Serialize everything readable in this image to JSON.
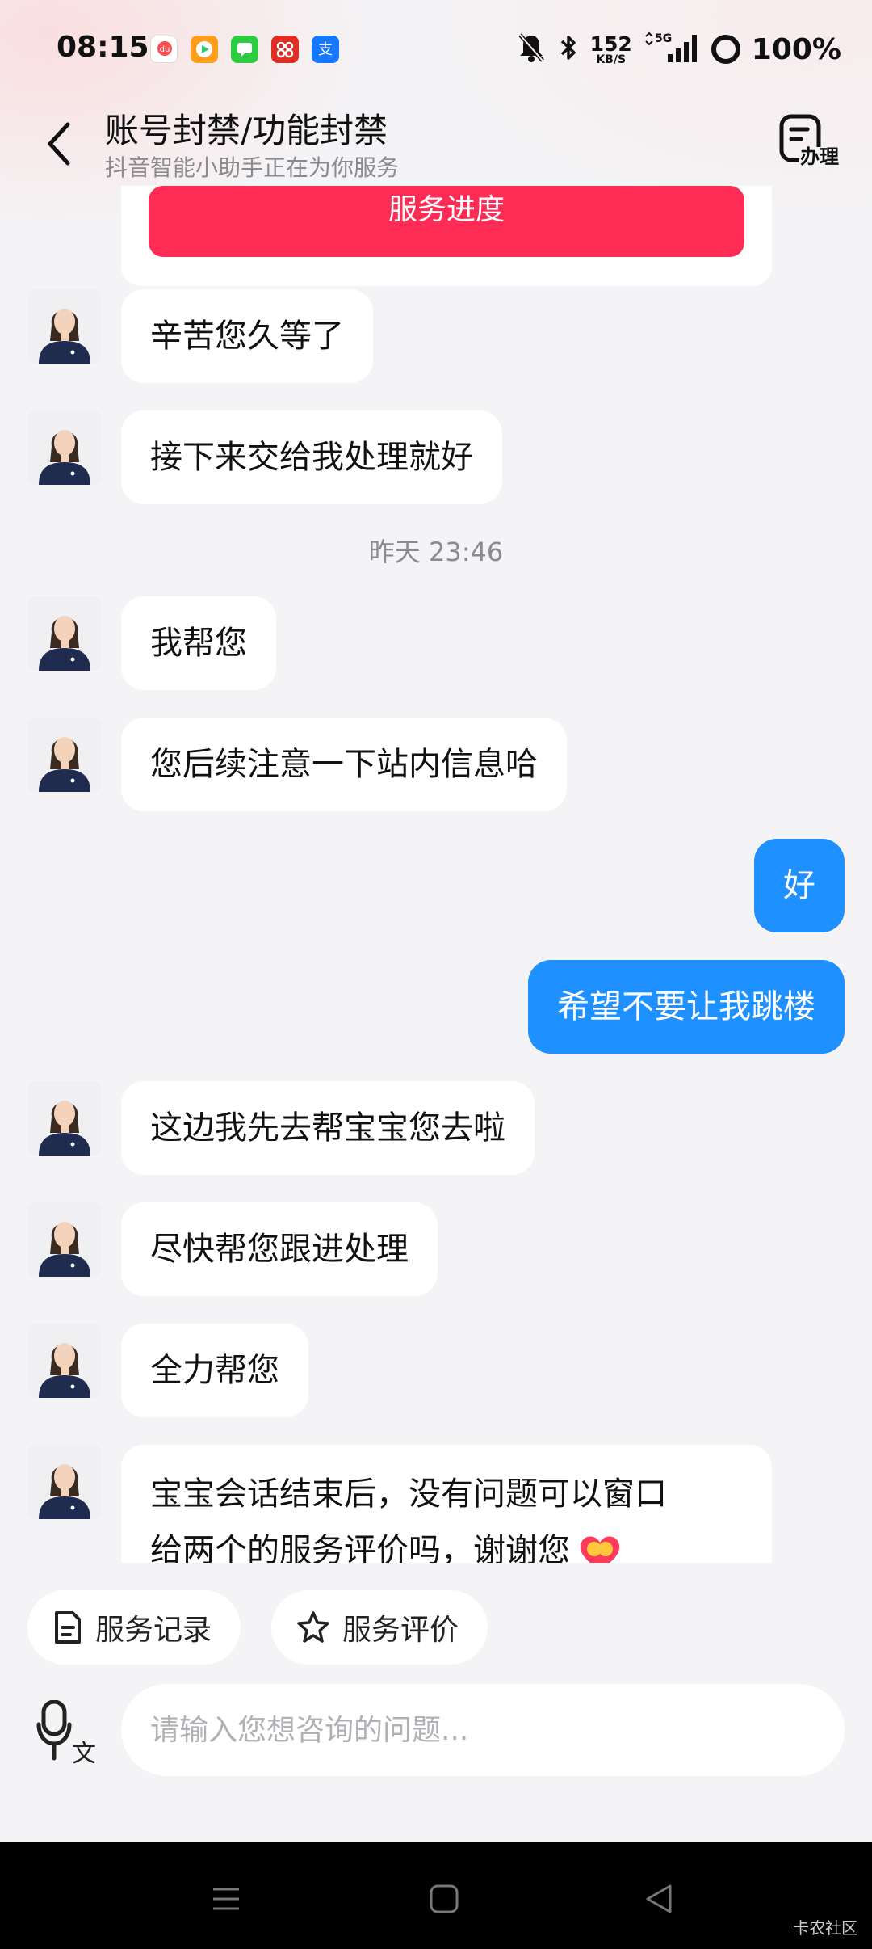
{
  "status_bar": {
    "time": "08:15",
    "net_speed_value": "152",
    "net_speed_unit": "KB/S",
    "network": "5G",
    "battery": "100%",
    "app_icons": [
      {
        "name": "baidu-map-icon",
        "color": "#ffffff",
        "accent": "#3b7cff",
        "text": "du"
      },
      {
        "name": "video-app-icon",
        "color": "#ff9e1b"
      },
      {
        "name": "messages-app-icon",
        "color": "#2ecc40"
      },
      {
        "name": "pinduoduo-app-icon",
        "color": "#e02e24"
      },
      {
        "name": "alipay-app-icon",
        "color": "#1677ff",
        "text": "支"
      }
    ]
  },
  "header": {
    "title": "账号封禁/功能封禁",
    "subtitle": "抖音智能小助手正在为你服务",
    "handle_label": "办理"
  },
  "card": {
    "progress_button_label": "服务进度"
  },
  "messages": [
    {
      "from": "agent",
      "text": "辛苦您久等了"
    },
    {
      "from": "agent",
      "text": "接下来交给我处理就好"
    },
    {
      "type": "timestamp",
      "text": "昨天 23:46"
    },
    {
      "from": "agent",
      "text": "我帮您"
    },
    {
      "from": "agent",
      "text": "您后续注意一下站内信息哈"
    },
    {
      "from": "user",
      "text": "好"
    },
    {
      "from": "user",
      "text": "希望不要让我跳楼"
    },
    {
      "from": "agent",
      "text": "这边我先去帮宝宝您去啦"
    },
    {
      "from": "agent",
      "text": "尽快帮您跟进处理"
    },
    {
      "from": "agent",
      "text": "全力帮您"
    },
    {
      "from": "agent",
      "line1": "宝宝会话结束后，没有问题可以窗口",
      "line2": "给两个的服务评价吗，谢谢您"
    }
  ],
  "quick_actions": [
    {
      "label": "服务记录",
      "icon": "document-icon"
    },
    {
      "label": "服务评价",
      "icon": "star-icon"
    }
  ],
  "input": {
    "placeholder": "请输入您想咨询的问题...",
    "voice_label": "文"
  },
  "watermark": "卡农社区",
  "colors": {
    "accent_red": "#fe2c55",
    "user_bubble": "#1e90ff",
    "background": "#f4f4f6"
  }
}
